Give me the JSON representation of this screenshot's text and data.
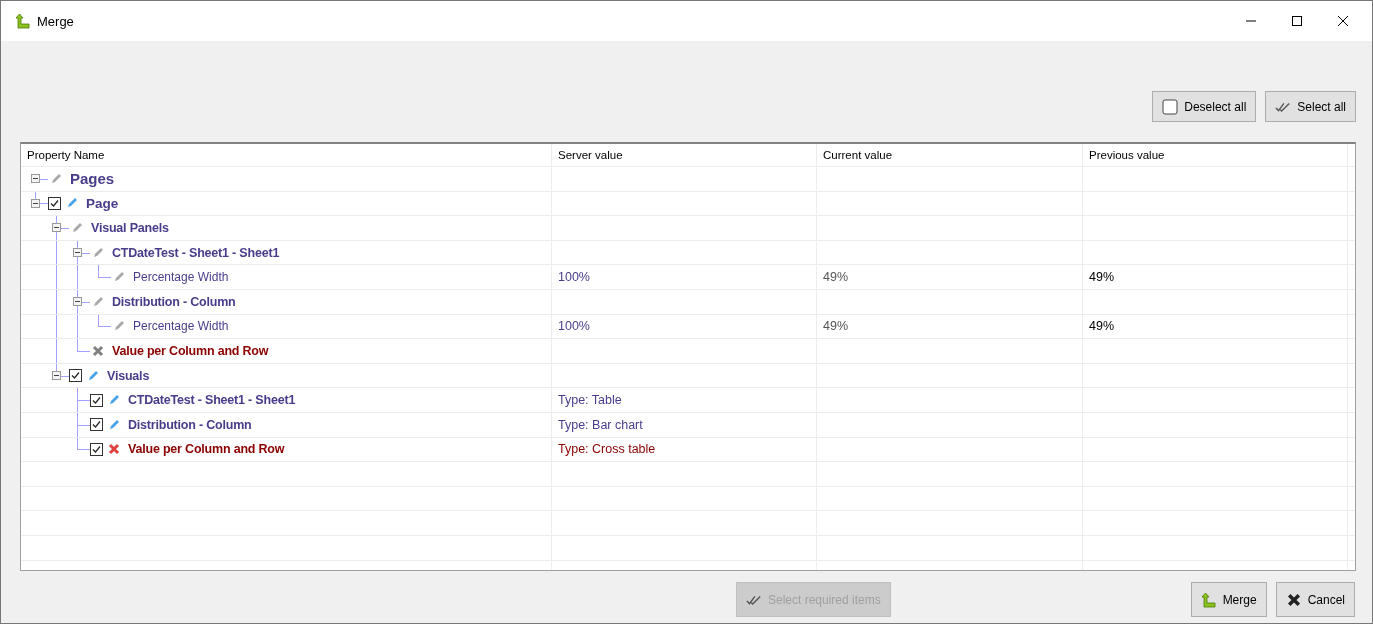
{
  "window": {
    "title": "Merge"
  },
  "top_buttons": [
    {
      "label": "Deselect all",
      "kind": "deselect"
    },
    {
      "label": "Select all",
      "kind": "select"
    }
  ],
  "table": {
    "columns": [
      "Property Name",
      "Server value",
      "Current value",
      "Previous value"
    ],
    "rows": [
      {
        "label": "Pages",
        "kind": "item",
        "active": false,
        "expanded": true,
        "children": [
          {
            "label": "Page",
            "kind": "item",
            "active": true,
            "checked": true,
            "expanded": true,
            "children": [
              {
                "label": "Visual Panels",
                "kind": "item",
                "active": false,
                "expanded": true,
                "children": [
                  {
                    "label": "CTDateTest - Sheet1 - Sheet1",
                    "kind": "item",
                    "active": false,
                    "expanded": true,
                    "children": [
                      {
                        "label": "Percentage Width",
                        "kind": "property",
                        "active": false,
                        "values": [
                          "100%",
                          "49%",
                          "49%"
                        ]
                      }
                    ]
                  },
                  {
                    "label": "Distribution - Column",
                    "kind": "item",
                    "active": false,
                    "expanded": true,
                    "children": [
                      {
                        "label": "Percentage Width",
                        "kind": "property",
                        "active": false,
                        "values": [
                          "100%",
                          "49%",
                          "49%"
                        ]
                      }
                    ]
                  },
                  {
                    "label": "Value per Column and Row",
                    "kind": "removed",
                    "active": false
                  }
                ]
              },
              {
                "label": "Visuals",
                "kind": "item",
                "active": true,
                "checked": true,
                "expanded": true,
                "children": [
                  {
                    "label": "CTDateTest - Sheet1 - Sheet1",
                    "kind": "item",
                    "active": true,
                    "checked": true,
                    "values": [
                      "Type: Table"
                    ]
                  },
                  {
                    "label": "Distribution - Column",
                    "kind": "item",
                    "active": true,
                    "checked": true,
                    "values": [
                      "Type: Bar chart"
                    ]
                  },
                  {
                    "label": "Value per Column and Row",
                    "kind": "removed",
                    "active": true,
                    "checked": true,
                    "values": [
                      "Type: Cross table"
                    ]
                  }
                ]
              }
            ]
          }
        ]
      }
    ]
  },
  "bottom_buttons": [
    {
      "label": "Select required items",
      "kind": "select",
      "disabled": true
    },
    {
      "label": "Merge",
      "kind": "merge",
      "disabled": false
    },
    {
      "label": "Cancel",
      "kind": "cancel",
      "disabled": false
    }
  ]
}
